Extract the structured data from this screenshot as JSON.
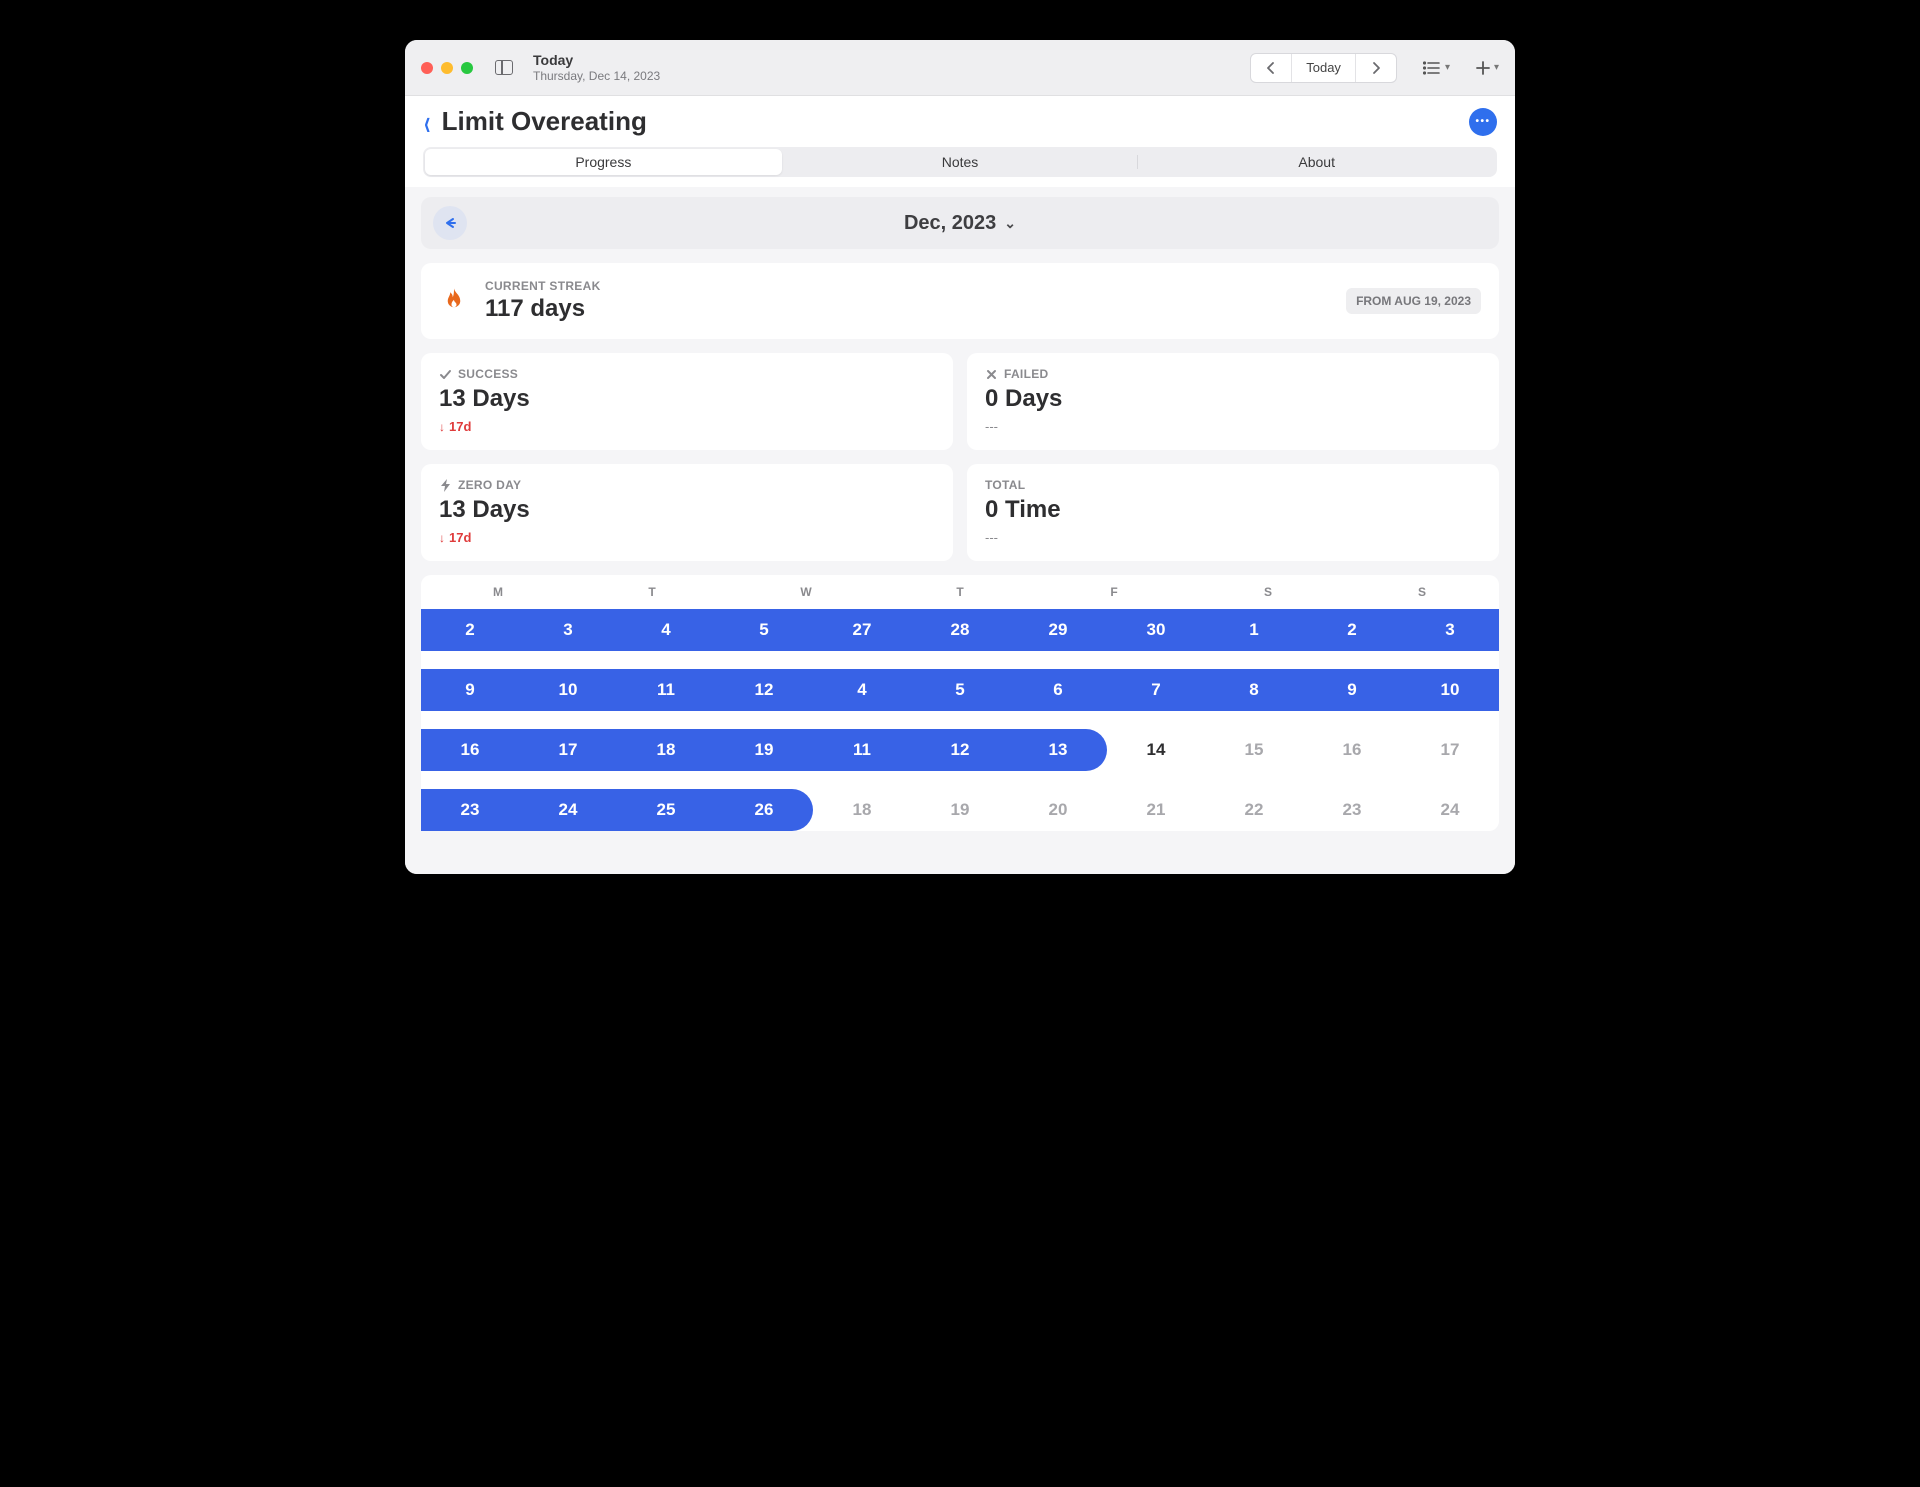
{
  "window": {
    "title": "Today",
    "subtitle": "Thursday, Dec 14, 2023",
    "today_button": "Today"
  },
  "page": {
    "title": "Limit Overeating"
  },
  "tabs": {
    "progress": "Progress",
    "notes": "Notes",
    "about": "About"
  },
  "month": {
    "label": "Dec, 2023"
  },
  "streak": {
    "label": "CURRENT STREAK",
    "value": "117 days",
    "from": "FROM AUG 19, 2023"
  },
  "stats": {
    "success": {
      "label": "SUCCESS",
      "value": "13 Days",
      "delta": "17d"
    },
    "failed": {
      "label": "FAILED",
      "value": "0 Days",
      "delta": "---"
    },
    "zeroday": {
      "label": "ZERO DAY",
      "value": "13 Days",
      "delta": "17d"
    },
    "total": {
      "label": "TOTAL",
      "value": "0 Time",
      "delta": "---"
    }
  },
  "calendar": {
    "dow": [
      "M",
      "T",
      "W",
      "T",
      "F",
      "S",
      "S"
    ],
    "rows": [
      {
        "band_start": 0,
        "band_end": 7,
        "cap": false,
        "cells": [
          {
            "n": "2",
            "on": true
          },
          {
            "n": "3",
            "on": true
          },
          {
            "n": "4",
            "on": true
          },
          {
            "n": "5",
            "on": true
          },
          {
            "n": "27",
            "on": true
          },
          {
            "n": "28",
            "on": true
          },
          {
            "n": "29",
            "on": true
          }
        ],
        "tail": [
          {
            "n": "30",
            "on": true
          },
          {
            "n": "1",
            "on": true
          },
          {
            "n": "2",
            "on": true
          },
          {
            "n": "3",
            "on": true
          }
        ]
      },
      {},
      {},
      {},
      {}
    ]
  },
  "calendar_rows": [
    [
      {
        "n": "2",
        "s": "on"
      },
      {
        "n": "3",
        "s": "on"
      },
      {
        "n": "4",
        "s": "on"
      },
      {
        "n": "5",
        "s": "on"
      },
      {
        "n": "27",
        "s": "on"
      },
      {
        "n": "28",
        "s": "on"
      },
      {
        "n": "29",
        "s": "on"
      },
      {
        "n": "30",
        "s": "on"
      },
      {
        "n": "1",
        "s": "on"
      },
      {
        "n": "2",
        "s": "on"
      },
      {
        "n": "3",
        "s": "on"
      }
    ],
    [
      {
        "n": "9",
        "s": "on"
      },
      {
        "n": "10",
        "s": "on"
      },
      {
        "n": "11",
        "s": "on"
      },
      {
        "n": "12",
        "s": "on"
      },
      {
        "n": "4",
        "s": "on"
      },
      {
        "n": "5",
        "s": "on"
      },
      {
        "n": "6",
        "s": "on"
      },
      {
        "n": "7",
        "s": "on"
      },
      {
        "n": "8",
        "s": "on"
      },
      {
        "n": "9",
        "s": "on"
      },
      {
        "n": "10",
        "s": "on"
      }
    ],
    [
      {
        "n": "16",
        "s": "on"
      },
      {
        "n": "17",
        "s": "on"
      },
      {
        "n": "18",
        "s": "on"
      },
      {
        "n": "19",
        "s": "on"
      },
      {
        "n": "11",
        "s": "on"
      },
      {
        "n": "12",
        "s": "on"
      },
      {
        "n": "13",
        "s": "on"
      },
      {
        "n": "14",
        "s": "today"
      },
      {
        "n": "15",
        "s": "future"
      },
      {
        "n": "16",
        "s": "future"
      },
      {
        "n": "17",
        "s": "future"
      }
    ],
    [
      {
        "n": "23",
        "s": "on"
      },
      {
        "n": "24",
        "s": "on"
      },
      {
        "n": "25",
        "s": "on"
      },
      {
        "n": "26",
        "s": "on"
      },
      {
        "n": "18",
        "s": "future"
      },
      {
        "n": "19",
        "s": "future"
      },
      {
        "n": "20",
        "s": "future"
      },
      {
        "n": "21",
        "s": "future"
      },
      {
        "n": "22",
        "s": "future"
      },
      {
        "n": "23",
        "s": "future"
      },
      {
        "n": "24",
        "s": "future"
      }
    ]
  ],
  "cal_display": {
    "dow": [
      "M",
      "T",
      "W",
      "T",
      "F",
      "S",
      "S"
    ],
    "rows": [
      {
        "band_end_pct": 100,
        "cap": false,
        "cells": [
          "2",
          "3",
          "4",
          "5",
          "27",
          "28",
          "29",
          "30",
          "1",
          "2",
          "3"
        ],
        "on_count": 11,
        "visible": [
          "2",
          "3",
          "4",
          "5",
          "27",
          "28",
          "29",
          "30",
          "1",
          "2",
          "3"
        ]
      },
      {
        "band_end_pct": 100,
        "cap": false
      },
      {
        "band_end_pct": 61,
        "cap": true
      },
      {
        "band_end_pct": 35,
        "cap": false
      }
    ]
  }
}
